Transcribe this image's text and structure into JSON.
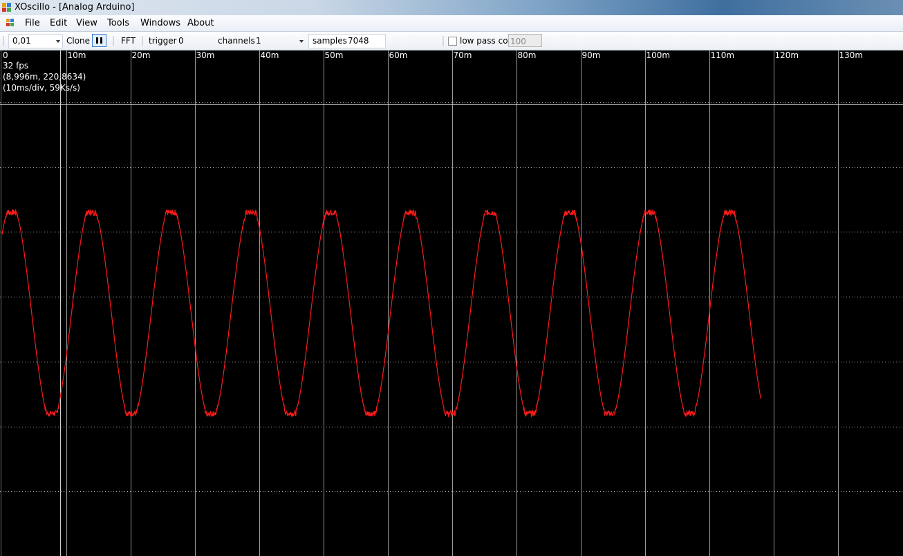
{
  "window": {
    "title": "XOscillo - [Analog Arduino]"
  },
  "menu": [
    {
      "label": "File"
    },
    {
      "label": "Edit"
    },
    {
      "label": "View"
    },
    {
      "label": "Tools"
    },
    {
      "label": "Windows"
    },
    {
      "label": "About"
    }
  ],
  "toolbar": {
    "timebase_value": "0,01",
    "clone_label": "Clone",
    "fft_label": "FFT",
    "trigger_label": "trigger",
    "trigger_value": "0",
    "channels_label": "channels",
    "channels_value": "1",
    "samples_label": "samples",
    "samples_value": "7048",
    "lowpass_label": "low pass cof",
    "lowpass_value": "100",
    "lowpass_checked": false
  },
  "scope": {
    "fps": "32 fps",
    "cursor": "(8,996m, 220,8634)",
    "rate": "(10ms/div, 59Ks/s)",
    "x_ticks": [
      "0",
      "10m",
      "20m",
      "30m",
      "40m",
      "50m",
      "60m",
      "70m",
      "80m",
      "90m",
      "100m",
      "110m",
      "120m",
      "130m"
    ],
    "trace_color": "#ff1a1a",
    "grid_color": "#bfbfbf"
  },
  "chart_data": {
    "type": "line",
    "x_unit": "s",
    "xlim": [
      0,
      0.1395
    ],
    "ylim": [
      0,
      7.8
    ],
    "x_ticks": [
      "0",
      "10m",
      "20m",
      "30m",
      "40m",
      "50m",
      "60m",
      "70m",
      "80m",
      "90m",
      "100m",
      "110m",
      "120m",
      "130m"
    ],
    "series": [
      {
        "color": "#ff1a1a",
        "period": 0.0124,
        "phase_peak": 0.0015,
        "max": 5.3,
        "min": 2.2,
        "x_start": 0.0,
        "x_end": 0.118
      }
    ],
    "cursor_x": 0.008996,
    "cursor_y_frac": 0.107
  }
}
